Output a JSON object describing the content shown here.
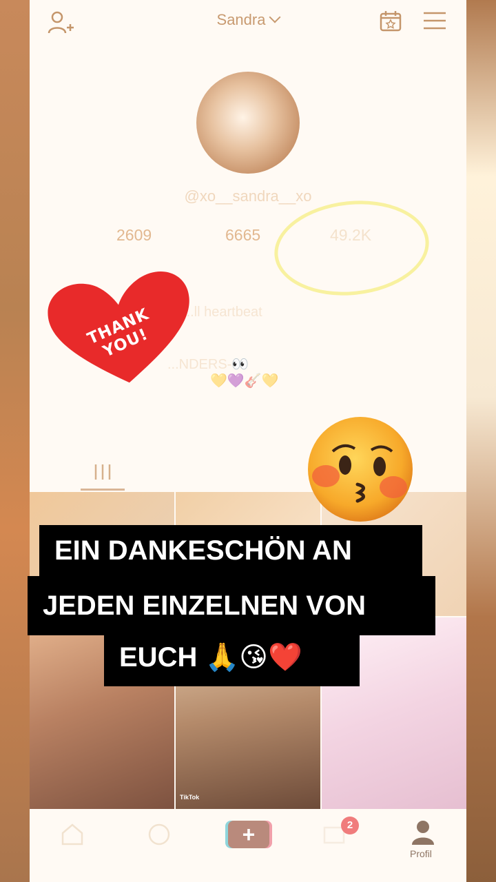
{
  "header": {
    "title": "Sandra",
    "add_user_icon": "add-user-icon",
    "calendar_icon": "calendar-star-icon",
    "menu_icon": "hamburger-menu-icon"
  },
  "profile": {
    "handle": "@xo__sandra__xo",
    "stats": [
      "2609",
      "6665",
      "49.2K"
    ],
    "bio_line1": "...ll heartbeat",
    "bio_line2": "...NDERS-👀",
    "bio_line3": "💛💜🎸💛"
  },
  "sticker": {
    "heart_text": "THANK YOU!"
  },
  "caption": {
    "line1": "EIN DANKESCHÖN AN",
    "line2": "JEDEN EINZELNEN VON",
    "line3": "EUCH 🙏😘❤️"
  },
  "bottom_nav": {
    "home_icon": "home-icon",
    "discover_icon": "compass-icon",
    "create_icon": "plus-icon",
    "inbox_icon": "inbox-icon",
    "inbox_badge": "2",
    "profile_icon": "profile-icon",
    "profile_label": "Profil"
  },
  "grid_thumbnail_watermark": "TikTok",
  "colors": {
    "accent_warm": "#c89a70",
    "caption_bg": "#000000",
    "caption_text": "#ffffff",
    "heart_red": "#e82a2a",
    "highlight_circle": "#f7ef8f"
  }
}
